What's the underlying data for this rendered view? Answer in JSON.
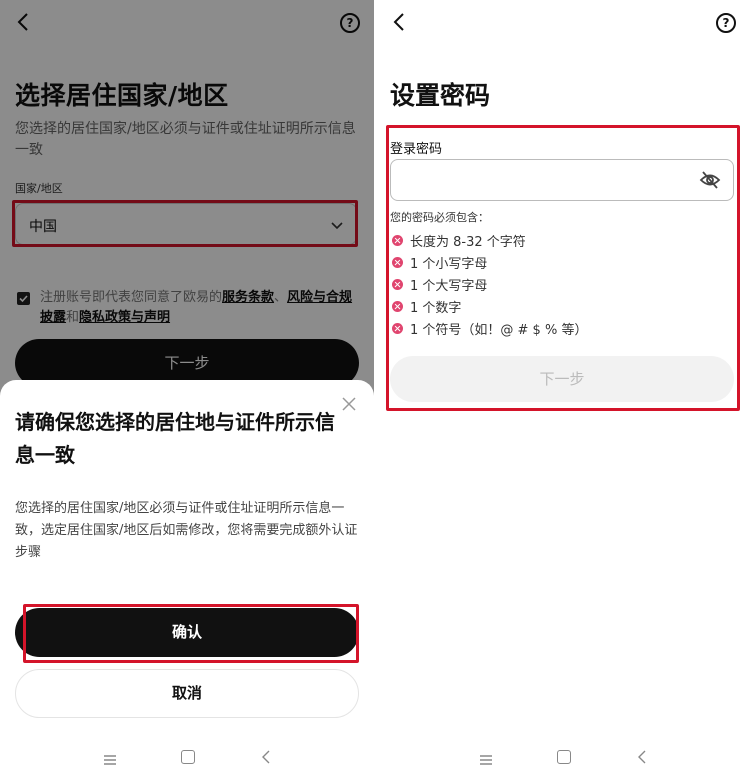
{
  "left": {
    "title": "选择居住国家/地区",
    "description": "您选择的居住国家/地区必须与证件或住址证明所示信息一致",
    "country_label": "国家/地区",
    "country_value": "中国",
    "terms": {
      "prefix": "注册账号即代表您同意了欧易的",
      "link1": "服务条款",
      "sep1": "、",
      "link2": "风险与合规披露",
      "sep2": "和",
      "link3": "隐私政策与声明"
    },
    "next_label": "下一步",
    "sheet": {
      "title": "请确保您选择的居住地与证件所示信息一致",
      "description": "您选择的居住国家/地区必须与证件或住址证明所示信息一致，选定居住国家/地区后如需修改，您将需要完成额外认证步骤",
      "confirm_label": "确认",
      "cancel_label": "取消"
    }
  },
  "right": {
    "title": "设置密码",
    "password_label": "登录密码",
    "password_value": "",
    "requirements_title": "您的密码必须包含：",
    "requirements": [
      "长度为 8-32 个字符",
      "1 个小写字母",
      "1 个大写字母",
      "1 个数字",
      "1 个符号（如！@ # $ % 等）"
    ],
    "next_label": "下一步"
  },
  "help_glyph": "?",
  "colors": {
    "highlight": "#d4142a",
    "primary_button": "#111111",
    "requirement_dot": "#e0456f",
    "disabled_button": "#f2f2f2"
  },
  "icons": [
    "back-icon",
    "help-icon",
    "chevron-down-icon",
    "close-icon",
    "eye-off-icon",
    "menu-icon",
    "home-icon"
  ]
}
